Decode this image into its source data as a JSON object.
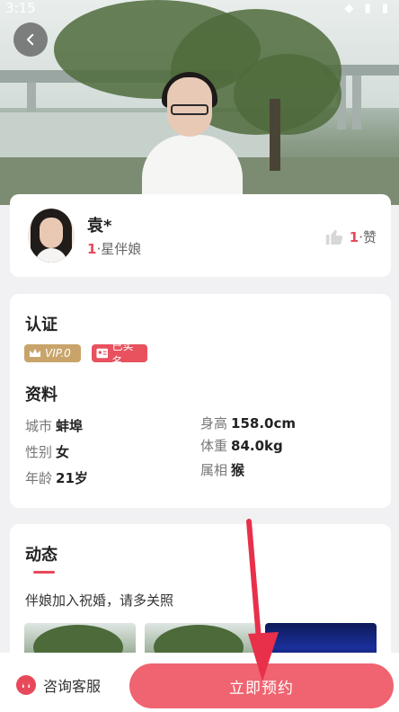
{
  "status": {
    "time": "3:15"
  },
  "profile": {
    "name": "袁*",
    "rank_num": "1",
    "rank_label": "·星伴娘",
    "likes_num": "1",
    "likes_label": "·赞"
  },
  "cert": {
    "title": "认证",
    "vip_label": "VIP.0",
    "real_label": "已实名"
  },
  "details": {
    "title": "资料",
    "city_label": "城市",
    "city_value": "蚌埠",
    "gender_label": "性别",
    "gender_value": "女",
    "age_label": "年龄",
    "age_value": "21岁",
    "height_label": "身高",
    "height_value": "158.0cm",
    "weight_label": "体重",
    "weight_value": "84.0kg",
    "zodiac_label": "属相",
    "zodiac_value": "猴"
  },
  "moments": {
    "title": "动态",
    "text": "伴娘加入祝婚，请多关照"
  },
  "bottom": {
    "service_label": "咨询客服",
    "book_label": "立即预约"
  },
  "colors": {
    "accent": "#e8495a",
    "book_button": "#ef6470",
    "vip_badge": "#c8a46b"
  }
}
